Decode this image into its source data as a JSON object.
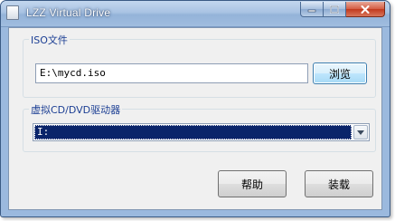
{
  "window": {
    "title": "LZZ Virtual Drive",
    "icon": "app-icon"
  },
  "caption_buttons": {
    "minimize_icon": "minimize-icon",
    "maximize_icon": "maximize-icon",
    "close_icon": "close-icon"
  },
  "iso_group": {
    "label": "ISO文件",
    "path_value": "E:\\mycd.iso",
    "browse_label": "浏览"
  },
  "drive_group": {
    "label": "虚拟CD/DVD驱动器",
    "selected_value": "I:",
    "dropdown_icon": "chevron-down-icon"
  },
  "actions": {
    "help_label": "帮助",
    "mount_label": "装载"
  },
  "colors": {
    "group_label": "#1c3f94",
    "selection": "#0a246a",
    "close_button": "#c1391e"
  }
}
